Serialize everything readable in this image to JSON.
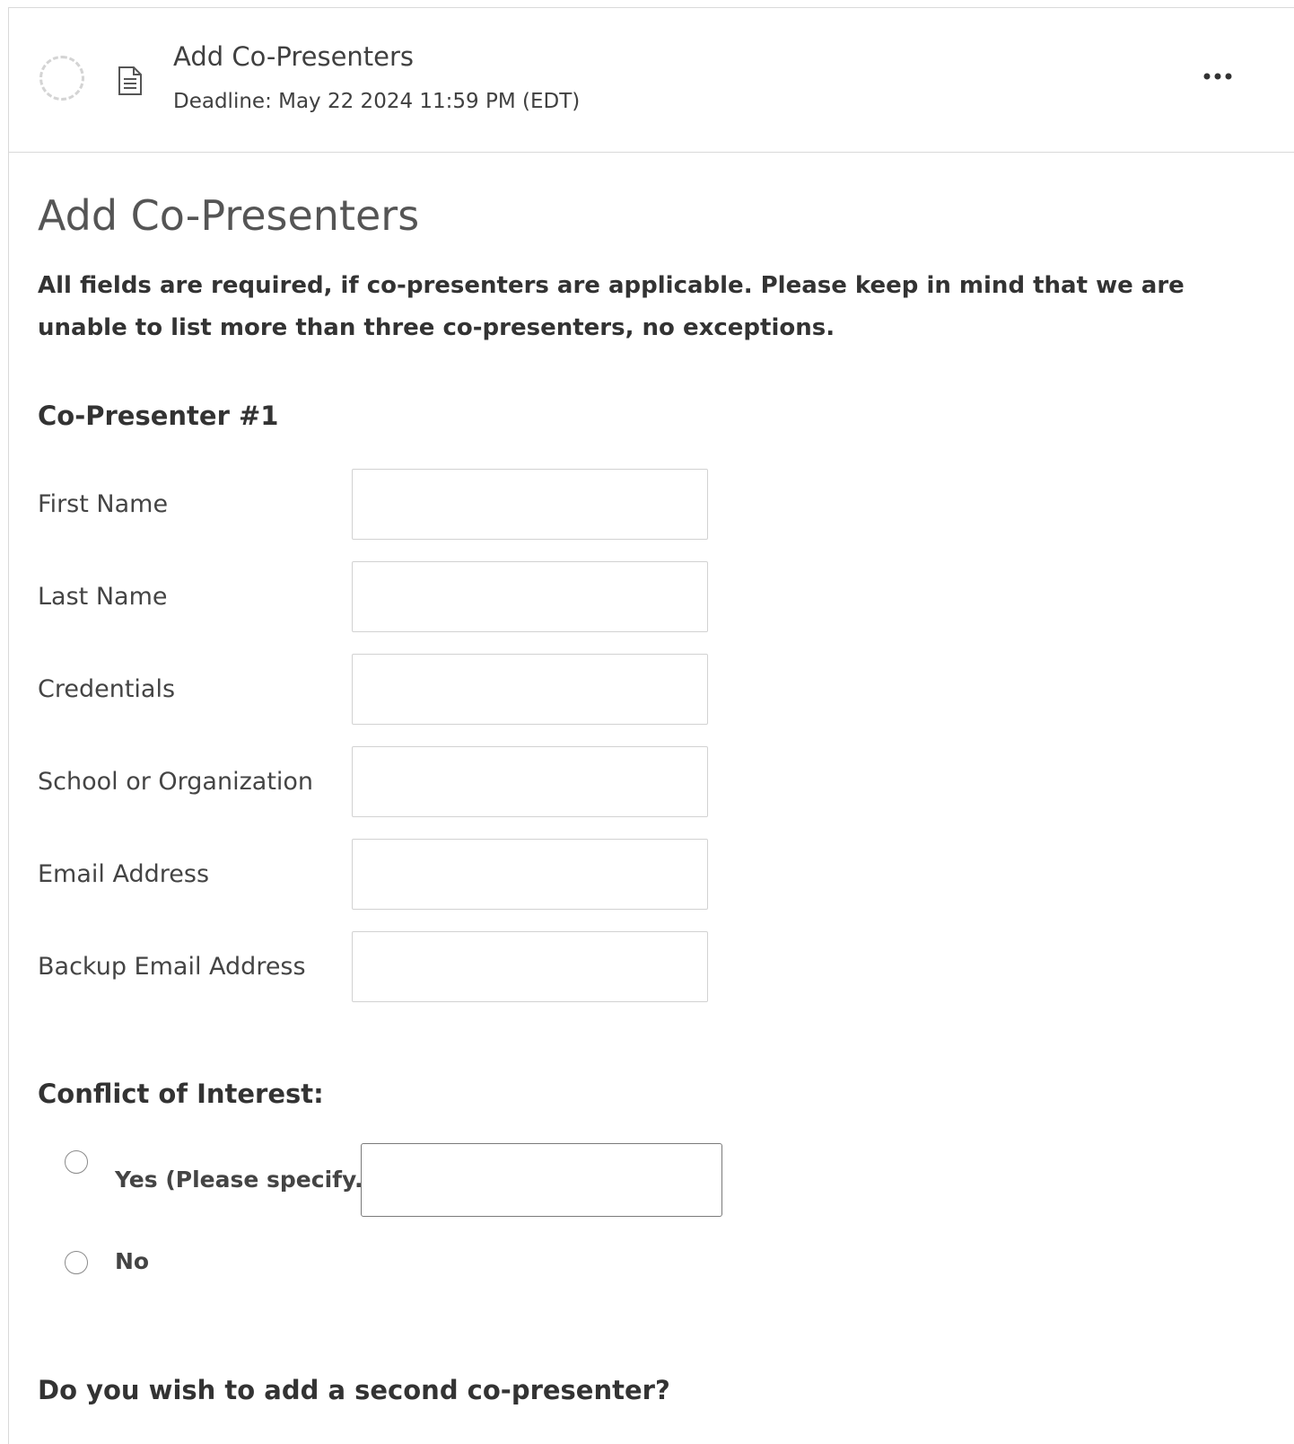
{
  "header": {
    "title": "Add Co-Presenters",
    "deadline": "Deadline: May 22 2024 11:59 PM (EDT)",
    "more_label": "•••"
  },
  "page": {
    "title": "Add Co-Presenters",
    "instructions": "All fields are required, if co-presenters are applicable. Please keep in mind that we are unable to list more than three co-presenters, no exceptions."
  },
  "co_presenter_1": {
    "heading": "Co-Presenter #1",
    "fields": [
      {
        "label": "First Name",
        "value": ""
      },
      {
        "label": "Last Name",
        "value": ""
      },
      {
        "label": "Credentials",
        "value": ""
      },
      {
        "label": "School or Organization",
        "value": ""
      },
      {
        "label": "Email Address",
        "value": ""
      },
      {
        "label": "Backup Email Address",
        "value": ""
      }
    ]
  },
  "conflict": {
    "heading": "Conflict of Interest:",
    "options": [
      {
        "label": "Yes (Please specify.)",
        "selected": false
      },
      {
        "label": "No",
        "selected": false
      }
    ],
    "specify_value": ""
  },
  "second_presenter": {
    "question": "Do you wish to add a second co-presenter?"
  },
  "icons": {
    "status": "status-pending-icon",
    "document": "document-icon",
    "more": "more-horizontal-icon"
  },
  "colors": {
    "border": "#d9d9d9",
    "text": "#333333",
    "muted_text": "#555555"
  }
}
